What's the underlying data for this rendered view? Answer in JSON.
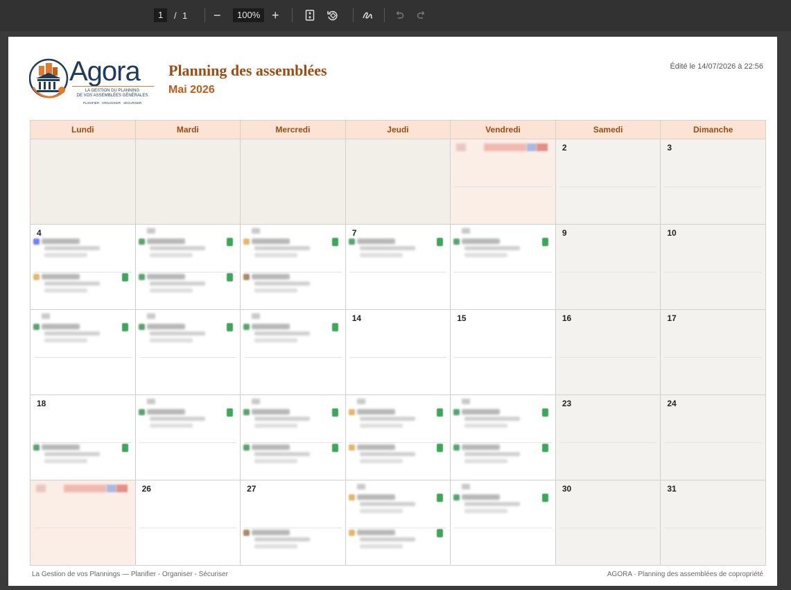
{
  "toolbar": {
    "page_current": "1",
    "page_sep": "/",
    "page_total": "1",
    "zoom_out": "−",
    "zoom": "100%",
    "zoom_in": "+",
    "icons": [
      "fit-page-icon",
      "rotate-icon",
      "draw-icon",
      "undo-icon",
      "redo-icon"
    ]
  },
  "header": {
    "logo_name": "Agora",
    "logo_tagline_1": "LA GESTION DU PLANNING",
    "logo_tagline_2": "DE VOS ASSEMBLÉES GÉNÉRALES",
    "logo_pill_1": "PLANIFIER",
    "logo_pill_2": "ORGANISER",
    "logo_pill_3": "SÉCURISER",
    "title": "Planning des assemblées",
    "subtitle": "Mai 2026",
    "edited": "Édité le 14/07/2026 à 22:56"
  },
  "calendar": {
    "days": [
      "Lundi",
      "Mardi",
      "Mercredi",
      "Jeudi",
      "Vendredi",
      "Samedi",
      "Dimanche"
    ],
    "weeks": [
      [
        {
          "d": "",
          "t": "empty"
        },
        {
          "d": "",
          "t": "empty"
        },
        {
          "d": "",
          "t": "empty"
        },
        {
          "d": "",
          "t": "empty"
        },
        {
          "d": "",
          "t": "hol"
        },
        {
          "d": "2",
          "t": "week"
        },
        {
          "d": "3",
          "t": "week"
        }
      ],
      [
        {
          "d": "4",
          "t": "white"
        },
        {
          "d": "",
          "t": "white"
        },
        {
          "d": "",
          "t": "white"
        },
        {
          "d": "7",
          "t": "white"
        },
        {
          "d": "",
          "t": "white"
        },
        {
          "d": "9",
          "t": "week"
        },
        {
          "d": "10",
          "t": "week"
        }
      ],
      [
        {
          "d": "",
          "t": "white"
        },
        {
          "d": "",
          "t": "white"
        },
        {
          "d": "",
          "t": "white"
        },
        {
          "d": "14",
          "t": "white"
        },
        {
          "d": "15",
          "t": "white"
        },
        {
          "d": "16",
          "t": "week"
        },
        {
          "d": "17",
          "t": "week"
        }
      ],
      [
        {
          "d": "18",
          "t": "white"
        },
        {
          "d": "",
          "t": "white"
        },
        {
          "d": "",
          "t": "white"
        },
        {
          "d": "",
          "t": "white"
        },
        {
          "d": "",
          "t": "white"
        },
        {
          "d": "23",
          "t": "week"
        },
        {
          "d": "24",
          "t": "week"
        }
      ],
      [
        {
          "d": "",
          "t": "hol"
        },
        {
          "d": "26",
          "t": "white"
        },
        {
          "d": "27",
          "t": "white"
        },
        {
          "d": "",
          "t": "white"
        },
        {
          "d": "",
          "t": "white"
        },
        {
          "d": "30",
          "t": "week"
        },
        {
          "d": "31",
          "t": "week"
        }
      ]
    ]
  },
  "colors": {
    "accent": "#a04a10",
    "header_bg": "#fbe4d6",
    "weekend_bg": "#f4f2ee",
    "holiday_bg": "#fbeee6"
  },
  "footer": {
    "left": "La Gestion de vos Plannings — Planifier - Organiser - Sécuriser",
    "right": "AGORA · Planning des assemblées de copropriété"
  }
}
